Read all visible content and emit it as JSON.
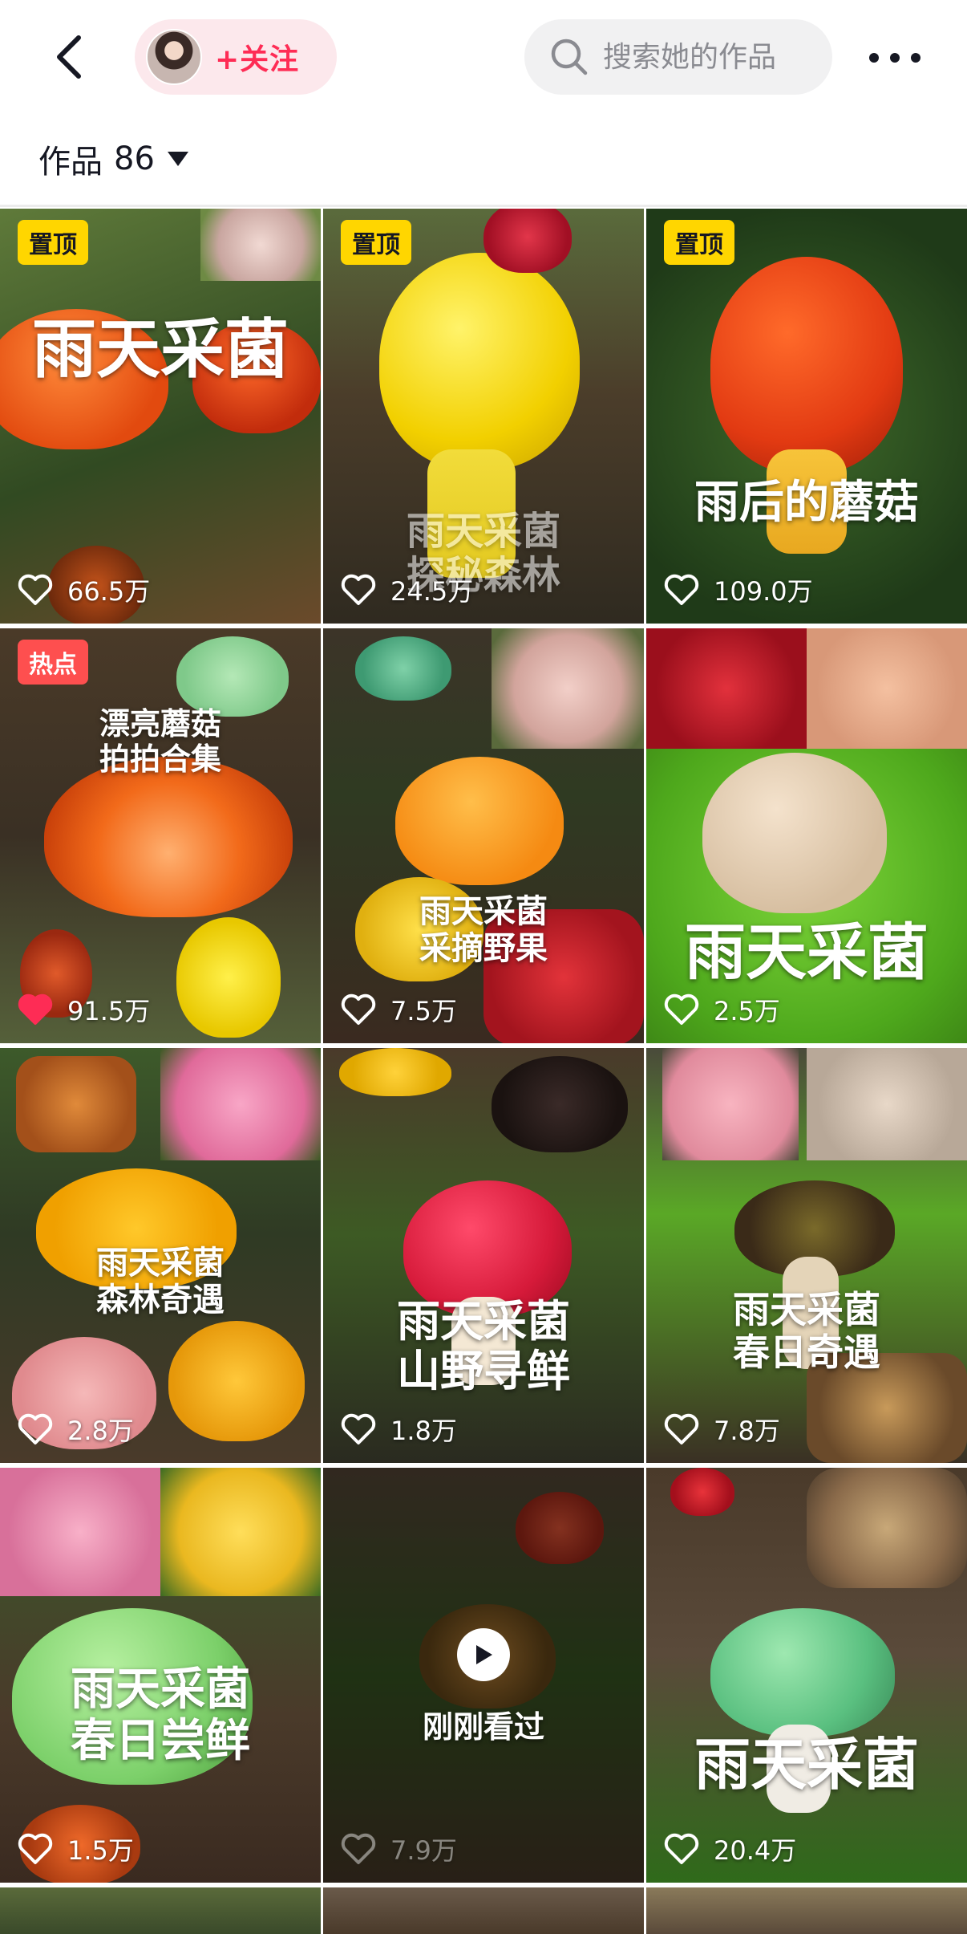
{
  "header": {
    "follow_label": "+关注",
    "search_placeholder": "搜索她的作品",
    "works_label": "作品",
    "works_count": "86"
  },
  "videos": [
    {
      "badge": "置顶",
      "badge_type": "pin",
      "title": "雨天采菌",
      "likes": "66.5万",
      "liked": false
    },
    {
      "badge": "置顶",
      "badge_type": "pin",
      "title": "雨天采菌\n探秘森林",
      "likes": "24.5万",
      "liked": false
    },
    {
      "badge": "置顶",
      "badge_type": "pin",
      "title": "雨后的蘑菇",
      "likes": "109.0万",
      "liked": false
    },
    {
      "badge": "热点",
      "badge_type": "hot",
      "title": "漂亮蘑菇\n拍拍合集",
      "likes": "91.5万",
      "liked": true
    },
    {
      "badge": "",
      "badge_type": "",
      "title": "雨天采菌\n采摘野果",
      "likes": "7.5万",
      "liked": false
    },
    {
      "badge": "",
      "badge_type": "",
      "title": "雨天采菌",
      "likes": "2.5万",
      "liked": false
    },
    {
      "badge": "",
      "badge_type": "",
      "title": "雨天采菌\n森林奇遇",
      "likes": "2.8万",
      "liked": false
    },
    {
      "badge": "",
      "badge_type": "",
      "title": "雨天采菌\n山野寻鲜",
      "likes": "1.8万",
      "liked": false
    },
    {
      "badge": "",
      "badge_type": "",
      "title": "雨天采菌\n春日奇遇",
      "likes": "7.8万",
      "liked": false
    },
    {
      "badge": "",
      "badge_type": "",
      "title": "雨天采菌\n春日尝鲜",
      "likes": "1.5万",
      "liked": false
    },
    {
      "badge": "",
      "badge_type": "",
      "title": "",
      "likes": "7.9万",
      "liked": false,
      "watched_label": "刚刚看过"
    },
    {
      "badge": "",
      "badge_type": "",
      "title": "雨天采菌",
      "likes": "20.4万",
      "liked": false
    }
  ],
  "colors": {
    "accent": "#fe2c55",
    "pin_badge": "#ffd600",
    "hot_badge": "#fe4f4f"
  },
  "icons": {
    "back": "chevron-left-icon",
    "search": "search-icon",
    "more": "more-dots-icon",
    "caret": "caret-down-icon",
    "like": "heart-icon",
    "play": "play-icon"
  }
}
